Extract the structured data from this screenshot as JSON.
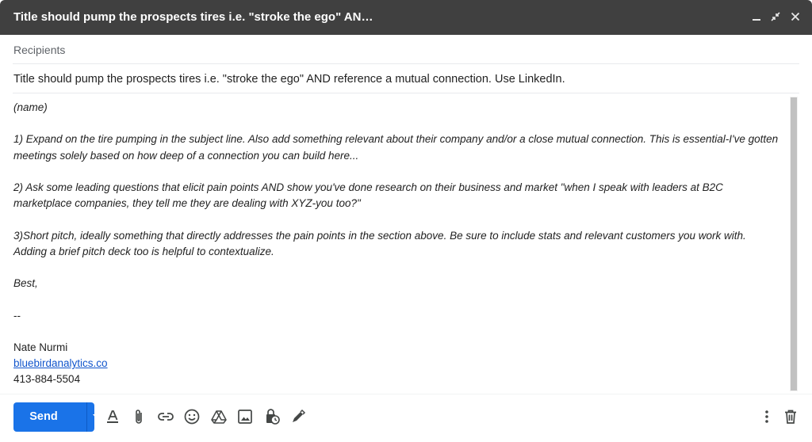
{
  "compose": {
    "title": "Title should pump the prospects tires i.e. \"stroke the ego\" AN…",
    "recipients_placeholder": "Recipients",
    "subject": "Title should pump the prospects tires i.e. \"stroke the ego\" AND reference a mutual connection. Use LinkedIn.",
    "body": {
      "name_line": "(name)",
      "point1_line1": "1) Expand on the tire pumping in the subject line. Also add something relevant about their company and/or a close mutual connection. This is essential-I've gotten",
      "point1_line2": "meetings solely based on how deep of a connection you can build here...",
      "point2_line1": "2) Ask some leading questions that elicit pain points AND show you've done research on their business and market \"when I speak with leaders at B2C",
      "point2_line2": "marketplace companies, they tell me they are dealing with XYZ-you too?\"",
      "point3_line1": "3)Short pitch, ideally something that directly addresses the pain points in the section above. Be sure to include stats and relevant customers you work with.",
      "point3_line2": "Adding a brief pitch deck too is helpful to contextualize.",
      "closing": "Best,",
      "sig_sep": "--",
      "sig_name": "Nate Nurmi",
      "sig_link": "bluebirdanalytics.co",
      "sig_phone": "413-884-5504"
    },
    "send_label": "Send"
  },
  "icons": {
    "window_controls": [
      "minimize-icon",
      "exit-fullscreen-icon",
      "close-icon"
    ],
    "toolbar": [
      "formatting-icon",
      "attach-icon",
      "link-icon",
      "emoji-icon",
      "drive-icon",
      "photo-icon",
      "confidential-mode-icon",
      "signature-icon",
      "more-options-icon",
      "trash-icon"
    ]
  },
  "colors": {
    "titlebar": "#404040",
    "send_button": "#1a73e8",
    "link": "#1155cc",
    "icon": "#444746"
  }
}
